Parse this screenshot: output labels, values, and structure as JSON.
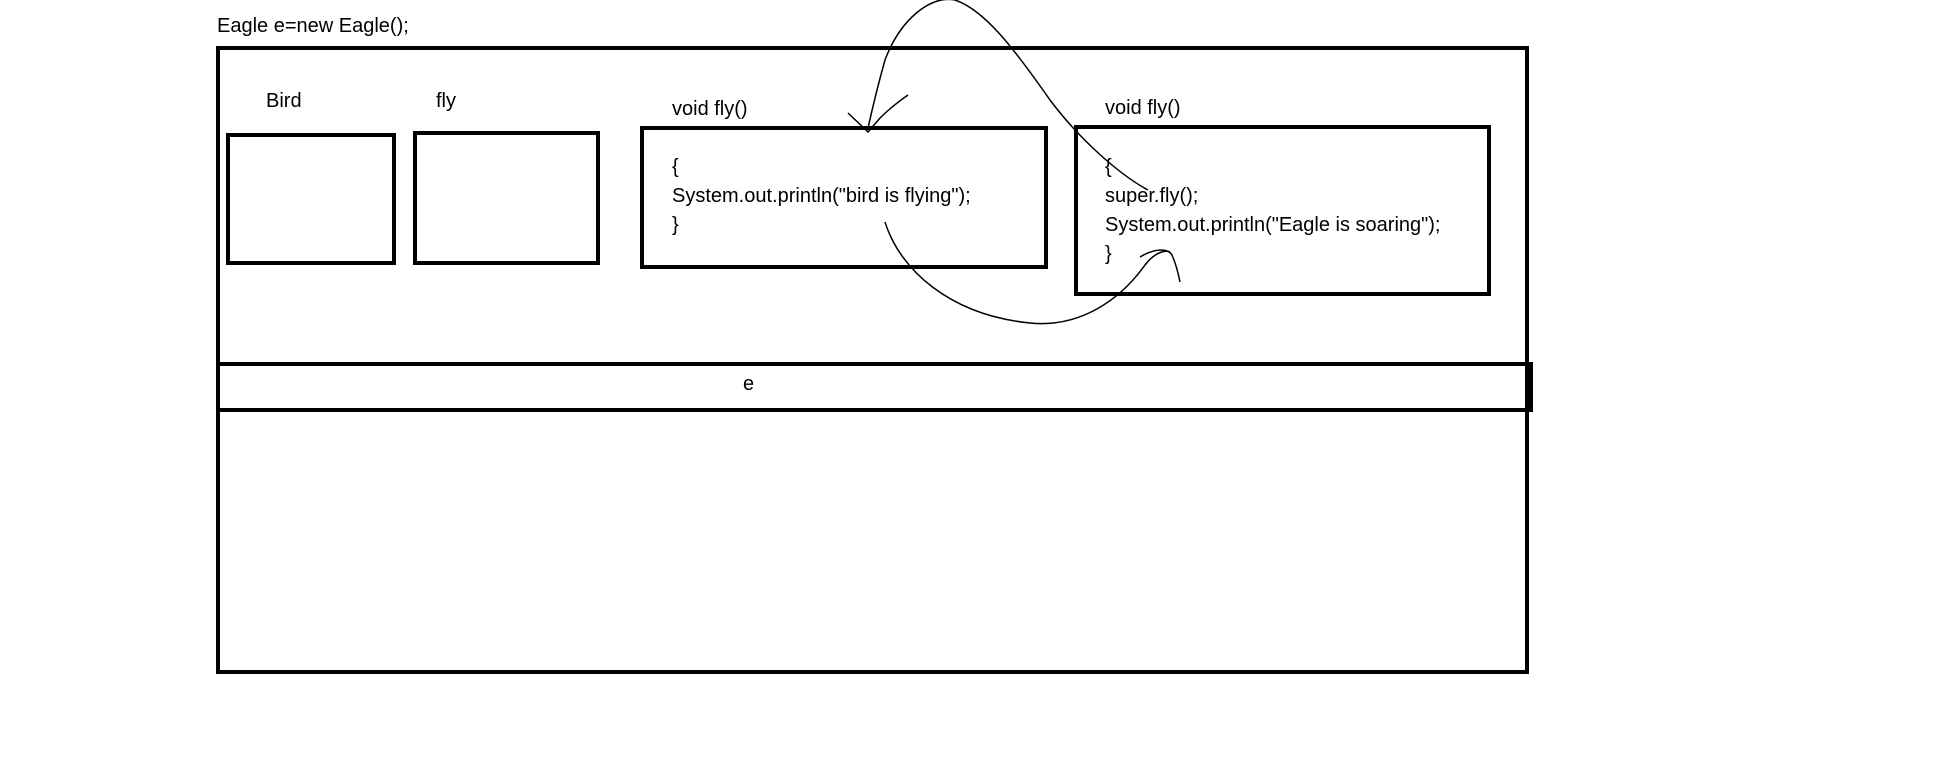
{
  "statement": "Eagle e=new Eagle();",
  "labels": {
    "bird": "Bird",
    "fly": "fly",
    "bird_method": "void fly()",
    "eagle_method": "void fly()"
  },
  "bird_method_body": {
    "open_brace": "{",
    "print_line": "System.out.println(\"bird is flying\");",
    "close_brace": "}"
  },
  "eagle_method_body": {
    "open_brace": "{",
    "super_call": "super.fly();",
    "print_line": "System.out.println(\"Eagle is soaring\");",
    "close_brace": "}"
  },
  "reference_label": "e",
  "colors": {
    "stroke": "#000000",
    "background": "#ffffff"
  }
}
